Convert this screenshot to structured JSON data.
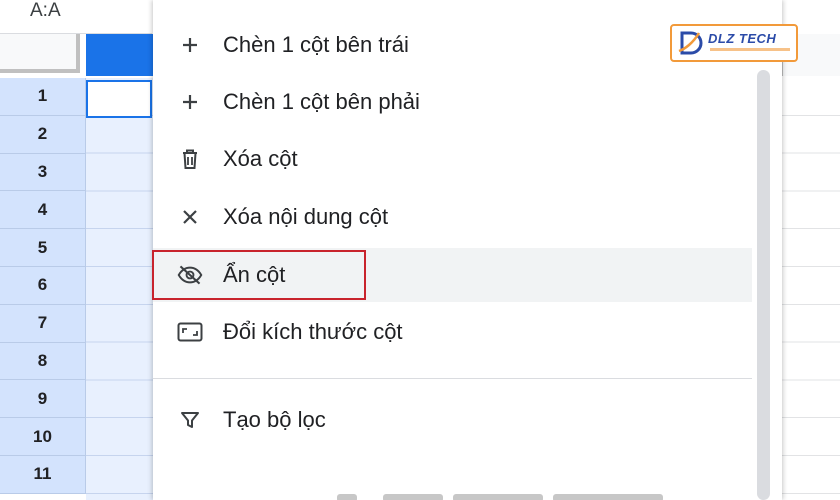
{
  "namebox": {
    "value": "A:A"
  },
  "rows": [
    "1",
    "2",
    "3",
    "4",
    "5",
    "6",
    "7",
    "8",
    "9",
    "10",
    "11"
  ],
  "menu": {
    "items": [
      {
        "icon": "plus-icon",
        "label": "Chèn 1 cột bên trái"
      },
      {
        "icon": "plus-icon",
        "label": "Chèn 1 cột bên phải"
      },
      {
        "icon": "trash-icon",
        "label": "Xóa cột"
      },
      {
        "icon": "close-icon",
        "label": "Xóa nội dung cột"
      },
      {
        "icon": "eye-off-icon",
        "label": "Ẩn cột"
      },
      {
        "icon": "resize-icon",
        "label": "Đổi kích thước cột"
      },
      {
        "icon": "filter-icon",
        "label": "Tạo bộ lọc"
      }
    ]
  },
  "logo": {
    "text": "DLZ TECH"
  },
  "colors": {
    "accent": "#1a73e8",
    "selection": "#d3e3fd",
    "highlight": "#c8232c",
    "logo_blue": "#2b4ba8",
    "logo_orange": "#f29a3a"
  }
}
